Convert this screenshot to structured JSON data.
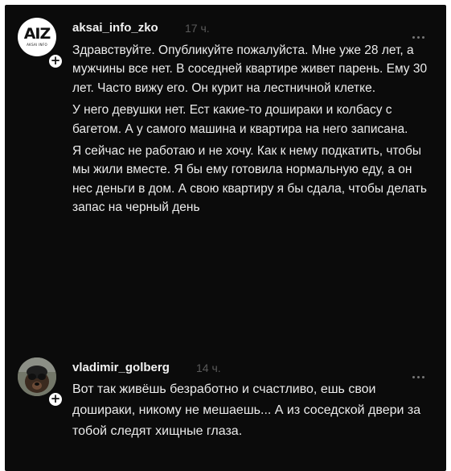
{
  "comments": [
    {
      "username": "aksai_info_zko",
      "time": "17 ч.",
      "avatar": {
        "logo_text": "AIZ",
        "logo_subtext": "AKSAI INFO"
      },
      "paragraphs": [
        "Здравствуйте. Опубликуйте пожалуйста. Мне уже 28 лет, а мужчины все нет. В соседней квартире живет парень. Ему 30 лет. Часто вижу его. Он курит на лестничной клетке.",
        "У него девушки нет. Ест какие-то дошираки и колбасу с багетом. А у самого машина и квартира на него записана.",
        "Я сейчас не работаю и не хочу. Как к нему подкатить, чтобы мы жили вместе. Я бы ему готовила нормальную еду, а он нес деньги в дом. А свою квартиру я бы сдала, чтобы делать запас на черный день"
      ]
    },
    {
      "username": "vladimir_golberg",
      "time": "14 ч.",
      "paragraphs": [
        "Вот так живёшь безработно и счастливо, ешь свои дошираки, никому не мешаешь... А из соседской двери за тобой следят хищные глаза."
      ]
    }
  ],
  "icons": {
    "follow": "plus-icon",
    "more": "more-options-icon"
  }
}
